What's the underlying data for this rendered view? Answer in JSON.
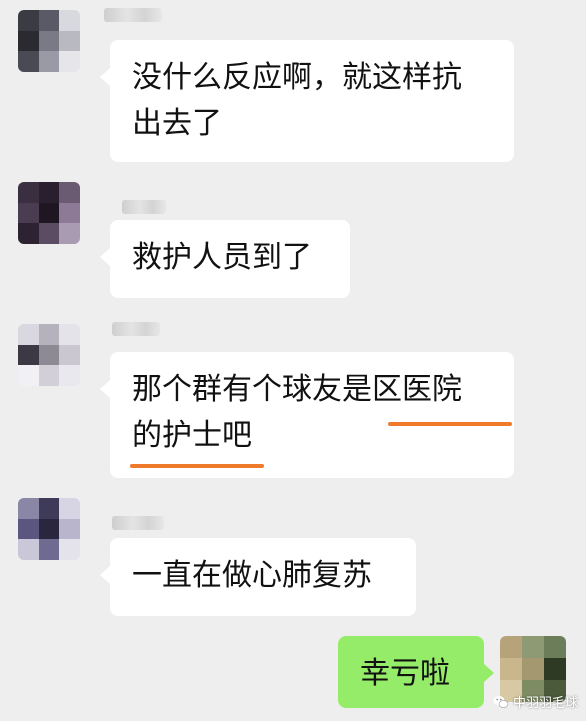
{
  "messages": [
    {
      "side": "left",
      "text_line1": "没什么反应啊，就这样抗",
      "text_line2": "出去了"
    },
    {
      "side": "left",
      "text_line1": "救护人员到了"
    },
    {
      "side": "left",
      "text_line1": "那个群有个球友是区医院",
      "text_line2": "的护士吧"
    },
    {
      "side": "left",
      "text_line1": "一直在做心肺复苏"
    },
    {
      "side": "right",
      "text_line1": "幸亏啦"
    }
  ],
  "watermark": {
    "text": "中羽羽毛球",
    "icon": "wechat-icon"
  },
  "colors": {
    "background": "#eeeeee",
    "incoming_bubble": "#ffffff",
    "outgoing_bubble": "#95ec69",
    "highlight_underline": "#f07a2c"
  }
}
